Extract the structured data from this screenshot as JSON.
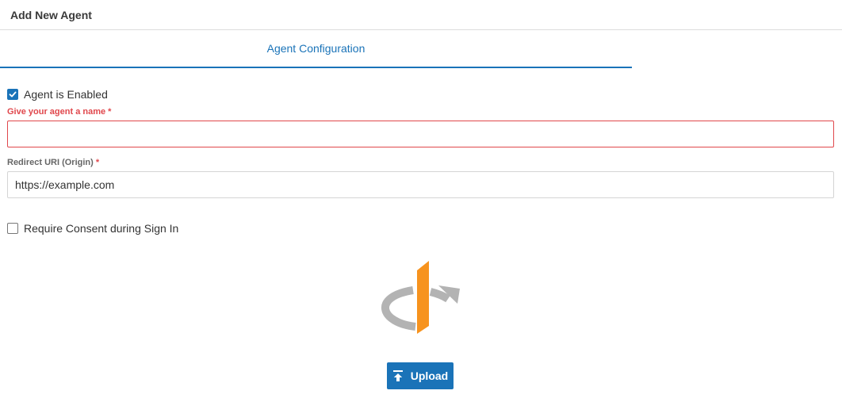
{
  "header": {
    "title": "Add New Agent"
  },
  "tabs": [
    {
      "label": "Agent Configuration",
      "active": true
    }
  ],
  "form": {
    "enabled": {
      "label": "Agent is Enabled",
      "checked": true
    },
    "name": {
      "label": "Give your agent a name",
      "required_mark": "*",
      "value": "",
      "state": "error"
    },
    "redirect": {
      "label": "Redirect URI (Origin)",
      "required_mark": "*",
      "value": "https://example.com"
    },
    "consent": {
      "label": "Require Consent during Sign In",
      "checked": false
    }
  },
  "logo": {
    "icon": "openid-logo-icon",
    "colors": {
      "orange": "#f7931e",
      "gray": "#b3b3b3"
    }
  },
  "upload": {
    "label": "Upload",
    "icon": "upload-icon"
  },
  "colors": {
    "accent": "#1a73b8",
    "error": "#e0474c"
  }
}
